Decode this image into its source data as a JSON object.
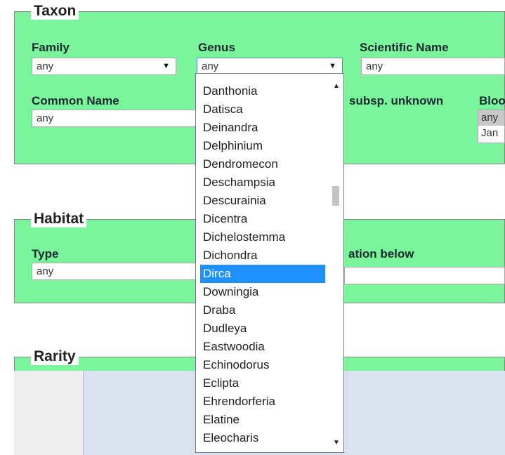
{
  "taxon": {
    "legend": "Taxon",
    "family_label": "Family",
    "family_value": "any",
    "genus_label": "Genus",
    "genus_value": "any",
    "scientific_name_label": "Scientific Name",
    "scientific_name_value": "any",
    "common_name_label": "Common Name",
    "common_name_value": "any",
    "subsp_label": "subsp. unknown",
    "bloom_label": "Bloo",
    "bloom_options": [
      "any",
      "Jan"
    ]
  },
  "habitat": {
    "legend": "Habitat",
    "type_label": "Type",
    "type_value": "any",
    "location_label": "ation below"
  },
  "rarity": {
    "legend": "Rarity"
  },
  "genus_dropdown": {
    "options": [
      "Danthonia",
      "Datisca",
      "Deinandra",
      "Delphinium",
      "Dendromecon",
      "Deschampsia",
      "Descurainia",
      "Dicentra",
      "Dichelostemma",
      "Dichondra",
      "Dirca",
      "Downingia",
      "Draba",
      "Dudleya",
      "Eastwoodia",
      "Echinodorus",
      "Eclipta",
      "Ehrendorferia",
      "Elatine",
      "Eleocharis"
    ],
    "highlighted": "Dirca"
  },
  "icons": {
    "dropdown_arrow": "triangle-down",
    "scroll_up": "triangle-up",
    "scroll_down": "triangle-down"
  }
}
